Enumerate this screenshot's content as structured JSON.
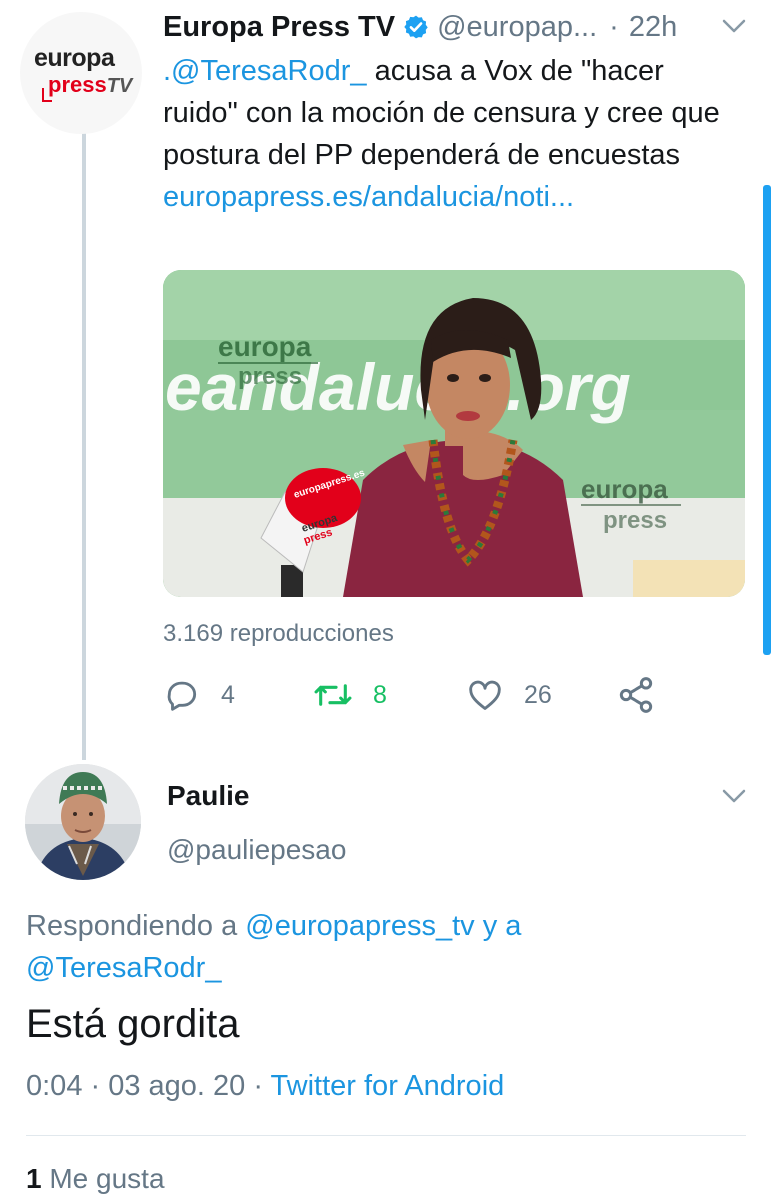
{
  "tweet": {
    "author_name": "Europa Press TV",
    "handle": "@europap...",
    "separator": "·",
    "time": "22h",
    "text_mention": ".@TeresaRodr_",
    "text_body": "  acusa a Vox de \"hacer ruido\" con la moción de censura y cree que postura del PP dependerá de encuestas ",
    "text_link": "europapress.es/andalucia/noti...",
    "avatar_logo": {
      "line1": "europa",
      "line2": "press",
      "line3": "TV"
    },
    "media_watermarks": [
      "europa",
      "press",
      "eandalucia.org",
      "europa",
      "press"
    ],
    "mic_labels": [
      "europapress.es",
      "europa",
      "press"
    ],
    "views": "3.169 reproducciones",
    "stats": {
      "replies": "4",
      "retweets": "8",
      "likes": "26"
    }
  },
  "reply": {
    "name": "Paulie",
    "handle": "@pauliepesao",
    "replying_prefix": "Respondiendo a ",
    "replying_user1": "@europapress_tv",
    "replying_and": " y a ",
    "replying_user2": "@TeresaRodr_",
    "text": "Está gordita",
    "time": "0:04 · 03 ago. 20 · ",
    "source": "Twitter for Android",
    "likes_count": "1",
    "likes_label": "Me gusta"
  },
  "colors": {
    "link": "#1b95e0",
    "retweet": "#17bf63",
    "muted": "#657786",
    "text": "#14171a",
    "brand_red": "#e2001a"
  },
  "icons": [
    "verified-badge-icon",
    "chevron-down-icon",
    "reply-icon",
    "retweet-icon",
    "like-icon",
    "share-icon"
  ]
}
